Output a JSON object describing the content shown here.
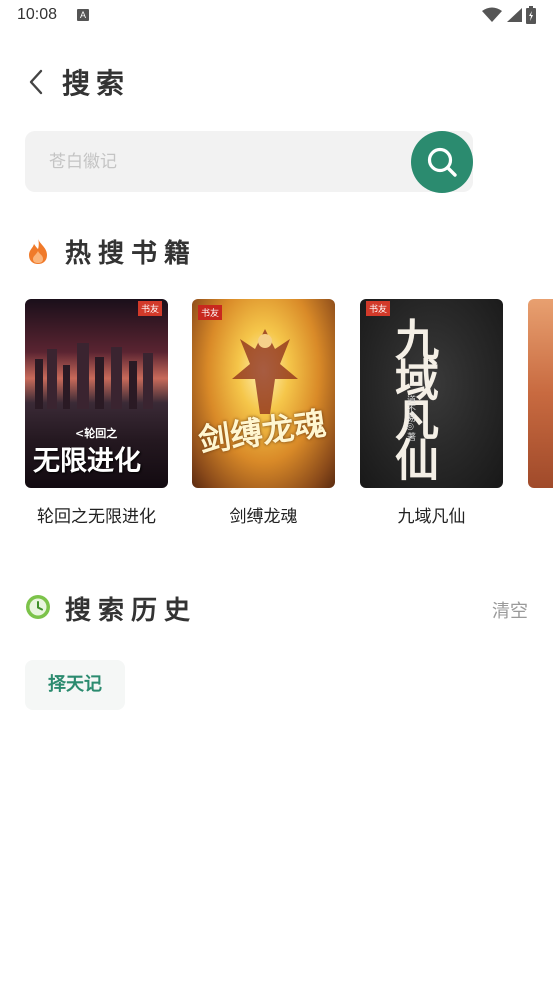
{
  "status_bar": {
    "time": "10:08",
    "notification_badge": "A",
    "icons": [
      "wifi-icon",
      "signal-icon",
      "battery-icon"
    ]
  },
  "header": {
    "back_icon": "chevron-left-icon",
    "title": "搜索"
  },
  "search": {
    "placeholder": "苍白徽记",
    "value": "",
    "button_icon": "search-icon"
  },
  "hot_books": {
    "title": "热搜书籍",
    "icon": "flame-icon",
    "items": [
      {
        "title": "轮回之无限进化",
        "cover_text": "无限进化",
        "cover_sub": "<轮回之",
        "tag": "书友"
      },
      {
        "title": "剑缚龙魂",
        "cover_text": "剑缚龙魂",
        "tag": "书友"
      },
      {
        "title": "九域凡仙",
        "cover_text": "九域凡仙",
        "cover_sub": "道不易◎著",
        "tag": "书友"
      },
      {
        "title": ""
      }
    ]
  },
  "history": {
    "title": "搜索历史",
    "icon": "clock-icon",
    "clear_label": "清空",
    "items": [
      "择天记"
    ]
  },
  "colors": {
    "accent": "#2b8b6f",
    "flame": "#f07a2a",
    "clock": "#7cc34a",
    "search_bg": "#f2f2f2"
  }
}
